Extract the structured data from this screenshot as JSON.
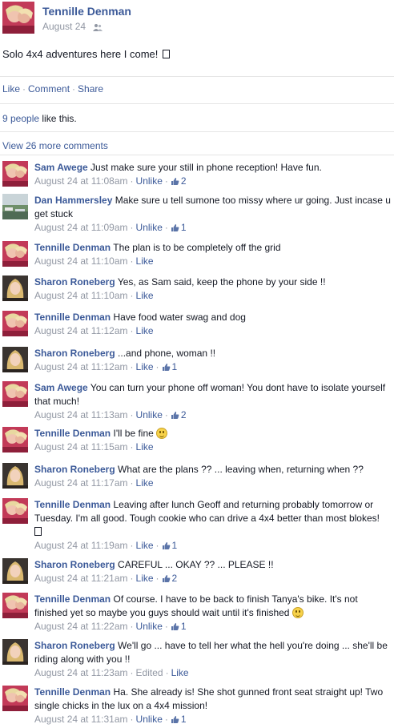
{
  "post": {
    "author": "Tennille Denman",
    "date": "August 24",
    "privacy_icon": "friends-icon",
    "status": "Solo 4x4 adventures here I come!",
    "actions": [
      "Like",
      "Comment",
      "Share"
    ],
    "likes": {
      "count_text": "9 people",
      "suffix": "like this."
    },
    "view_more": "View 26 more comments"
  },
  "colors": {
    "link": "#3b5998",
    "meta": "#9197a3",
    "text": "#141823",
    "divider": "#e5e5e5"
  },
  "comments": [
    {
      "author": "Sam Awege",
      "avatar": "tennille-like",
      "text": "Just make sure your still in phone reception! Have fun.",
      "time": "August 24 at 11:08am",
      "action": "Unlike",
      "likes": "2"
    },
    {
      "author": "Dan Hammersley",
      "avatar": "landscape",
      "text": "Make sure u tell sumone too missy where ur going. Just incase u get stuck",
      "time": "August 24 at 11:09am",
      "action": "Unlike",
      "likes": "1"
    },
    {
      "author": "Tennille Denman",
      "avatar": "tennille",
      "text": "The plan is to be completely off the grid",
      "time": "August 24 at 11:10am",
      "action": "Like",
      "likes": ""
    },
    {
      "author": "Sharon Roneberg",
      "avatar": "sharon",
      "text": "Yes, as Sam said, keep the phone by your side !!",
      "time": "August 24 at 11:10am",
      "action": "Like",
      "likes": ""
    },
    {
      "author": "Tennille Denman",
      "avatar": "tennille",
      "text": "Have food water swag and dog",
      "time": "August 24 at 11:12am",
      "action": "Like",
      "likes": ""
    },
    {
      "author": "Sharon Roneberg",
      "avatar": "sharon",
      "text": "...and phone, woman !!",
      "time": "August 24 at 11:12am",
      "action": "Like",
      "likes": "1"
    },
    {
      "author": "Sam Awege",
      "avatar": "tennille-like",
      "text": "You can turn your phone off woman! You dont have to isolate yourself that much!",
      "time": "August 24 at 11:13am",
      "action": "Unlike",
      "likes": "2"
    },
    {
      "author": "Tennille Denman",
      "avatar": "tennille",
      "text": "I'll be fine",
      "emoji": true,
      "time": "August 24 at 11:15am",
      "action": "Like",
      "likes": ""
    },
    {
      "author": "Sharon Roneberg",
      "avatar": "sharon",
      "text": "What are the plans ?? ... leaving when, returning when ??",
      "time": "August 24 at 11:17am",
      "action": "Like",
      "likes": ""
    },
    {
      "author": "Tennille Denman",
      "avatar": "tennille",
      "text": "Leaving after lunch Geoff and returning probably tomorrow or Tuesday. I'm all good. Tough cookie who can drive a 4x4 better than most blokes!",
      "boxglyph": true,
      "time": "August 24 at 11:19am",
      "action": "Like",
      "likes": "1"
    },
    {
      "author": "Sharon Roneberg",
      "avatar": "sharon",
      "text": "CAREFUL ... OKAY ?? ... PLEASE !!",
      "time": "August 24 at 11:21am",
      "action": "Like",
      "likes": "2"
    },
    {
      "author": "Tennille Denman",
      "avatar": "tennille",
      "text": "Of course. I have to be back to finish Tanya's bike. It's not finished yet so maybe you guys should wait until it's finished",
      "emoji": true,
      "time": "August 24 at 11:22am",
      "action": "Unlike",
      "likes": "1"
    },
    {
      "author": "Sharon Roneberg",
      "avatar": "sharon",
      "text": "We'll go ... have to tell her what the hell you're doing ... she'll be riding along with you !!",
      "time": "August 24 at 11:23am",
      "edited": "Edited",
      "action": "Like",
      "likes": ""
    },
    {
      "author": "Tennille Denman",
      "avatar": "tennille",
      "text": "Ha. She already is! She shot gunned front seat straight up! Two single chicks in the lux on a 4x4 mission!",
      "time": "August 24 at 11:31am",
      "action": "Unlike",
      "likes": "1"
    }
  ]
}
